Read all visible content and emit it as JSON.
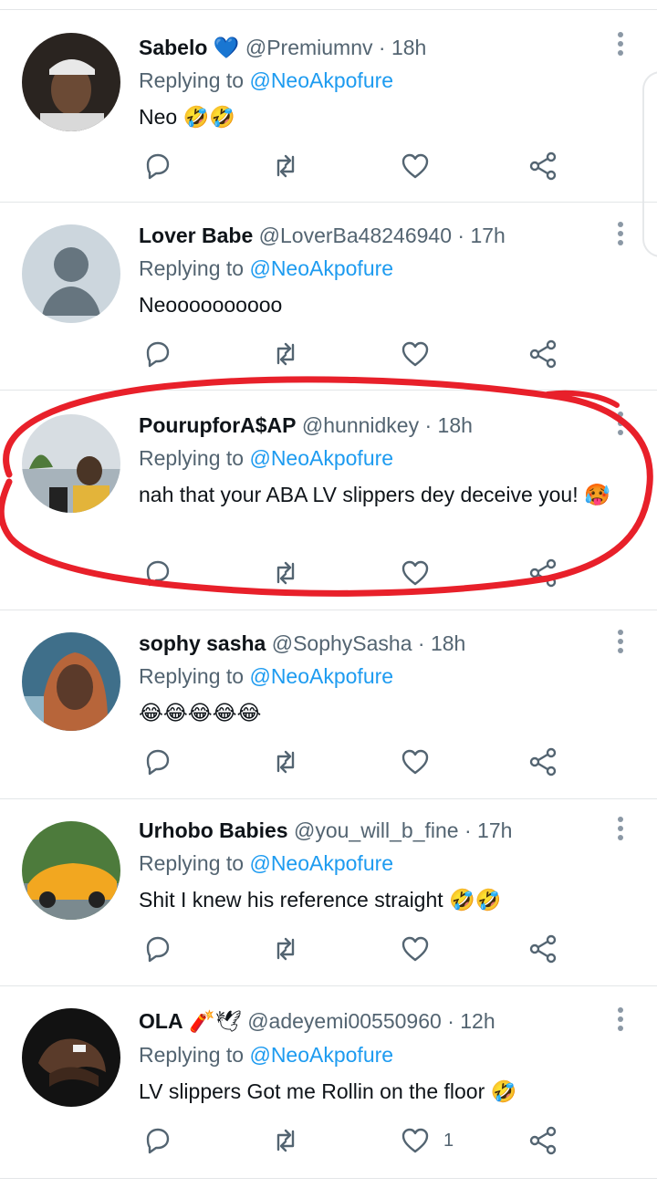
{
  "reply_prefix": "Replying to",
  "reply_target": "@NeoAkpofure",
  "tweets": [
    {
      "name": "Sabelo",
      "name_badge": "💙",
      "handle": "@Premiumnv",
      "time": "· 18h",
      "text": "Neo 🤣🤣",
      "likes": ""
    },
    {
      "name": "Lover Babe",
      "name_badge": "",
      "handle": "@LoverBa48246940",
      "time": "· 17h",
      "text": "Neoooooooooo",
      "likes": ""
    },
    {
      "name": "PourupforA$AP",
      "name_badge": "",
      "handle": "@hunnidkey",
      "time": "· 18h",
      "text": "nah that your ABA LV slippers dey deceive you! 🥵",
      "likes": ""
    },
    {
      "name": "sophy sasha",
      "name_badge": "",
      "handle": "@SophySasha",
      "time": "· 18h",
      "text": "😂😂😂😂😂",
      "likes": ""
    },
    {
      "name": "Urhobo Babies",
      "name_badge": "",
      "handle": "@you_will_b_fine",
      "time": "· 17h",
      "text": "Shit I knew his reference straight 🤣🤣",
      "likes": ""
    },
    {
      "name": "OLA",
      "name_badge": "🧨🕊",
      "handle": "@adeyemi00550960",
      "time": "· 12h",
      "text": "LV slippers Got me Rollin on the floor 🤣",
      "likes": "1"
    }
  ],
  "colors": {
    "link": "#1d9bf0",
    "muted": "#536471",
    "highlight": "#e8202a"
  }
}
